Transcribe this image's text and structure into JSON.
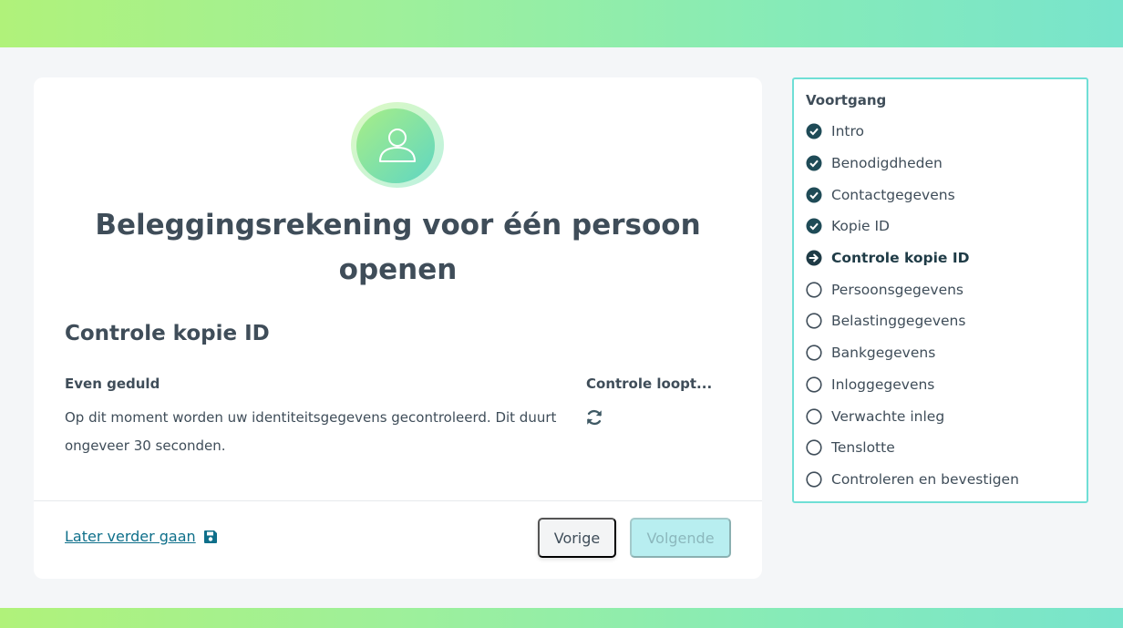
{
  "main": {
    "title": "Beleggingsrekening voor één persoon openen",
    "section_title": "Controle kopie ID",
    "wait_label": "Even geduld",
    "wait_text": "Op dit moment worden uw identiteitsgegevens gecontroleerd. Dit duurt ongeveer 30 seconden.",
    "status_label": "Controle loopt...",
    "later_link": "Later verder gaan",
    "prev_button": "Vorige",
    "next_button": "Volgende"
  },
  "progress": {
    "title": "Voortgang",
    "steps": [
      {
        "label": "Intro",
        "state": "done"
      },
      {
        "label": "Benodigdheden",
        "state": "done"
      },
      {
        "label": "Contactgegevens",
        "state": "done"
      },
      {
        "label": "Kopie ID",
        "state": "done"
      },
      {
        "label": "Controle kopie ID",
        "state": "current"
      },
      {
        "label": "Persoonsgegevens",
        "state": "todo"
      },
      {
        "label": "Belastinggegevens",
        "state": "todo"
      },
      {
        "label": "Bankgegevens",
        "state": "todo"
      },
      {
        "label": "Inloggegevens",
        "state": "todo"
      },
      {
        "label": "Verwachte inleg",
        "state": "todo"
      },
      {
        "label": "Tenslotte",
        "state": "todo"
      },
      {
        "label": "Controleren en bevestigen",
        "state": "todo"
      }
    ]
  },
  "colors": {
    "accent": "#0e6f8a",
    "icon_dark": "#1f4b57",
    "progress_border": "#6fdfd6",
    "next_disabled": "#b8eef0"
  },
  "icons": {
    "header": "user-icon",
    "done": "check-circle-icon",
    "current": "arrow-circle-icon",
    "todo": "empty-circle-icon",
    "status": "sync-icon",
    "save": "floppy-disk-icon"
  }
}
